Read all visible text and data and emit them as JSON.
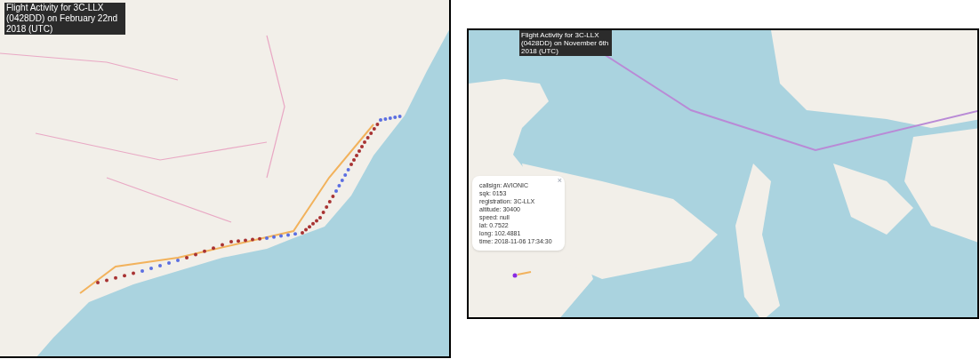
{
  "maps": [
    {
      "title": "Flight Activity for 3C-LLX (0428DD) on February 22nd 2018 (UTC)",
      "kind": "coast"
    },
    {
      "title": "Flight Activity for 3C-LLX (0428DD) on November 6th 2018 (UTC)",
      "kind": "strait",
      "popup": {
        "close": "×",
        "lines": [
          "callsign: AVIONIC",
          "sqk: 0153",
          "registration: 3C-LLX",
          "altitude: 30400",
          "speed: null",
          "lat: 0.7522",
          "long: 102.4881",
          "time: 2018-11-06 17:34:30"
        ]
      }
    }
  ]
}
